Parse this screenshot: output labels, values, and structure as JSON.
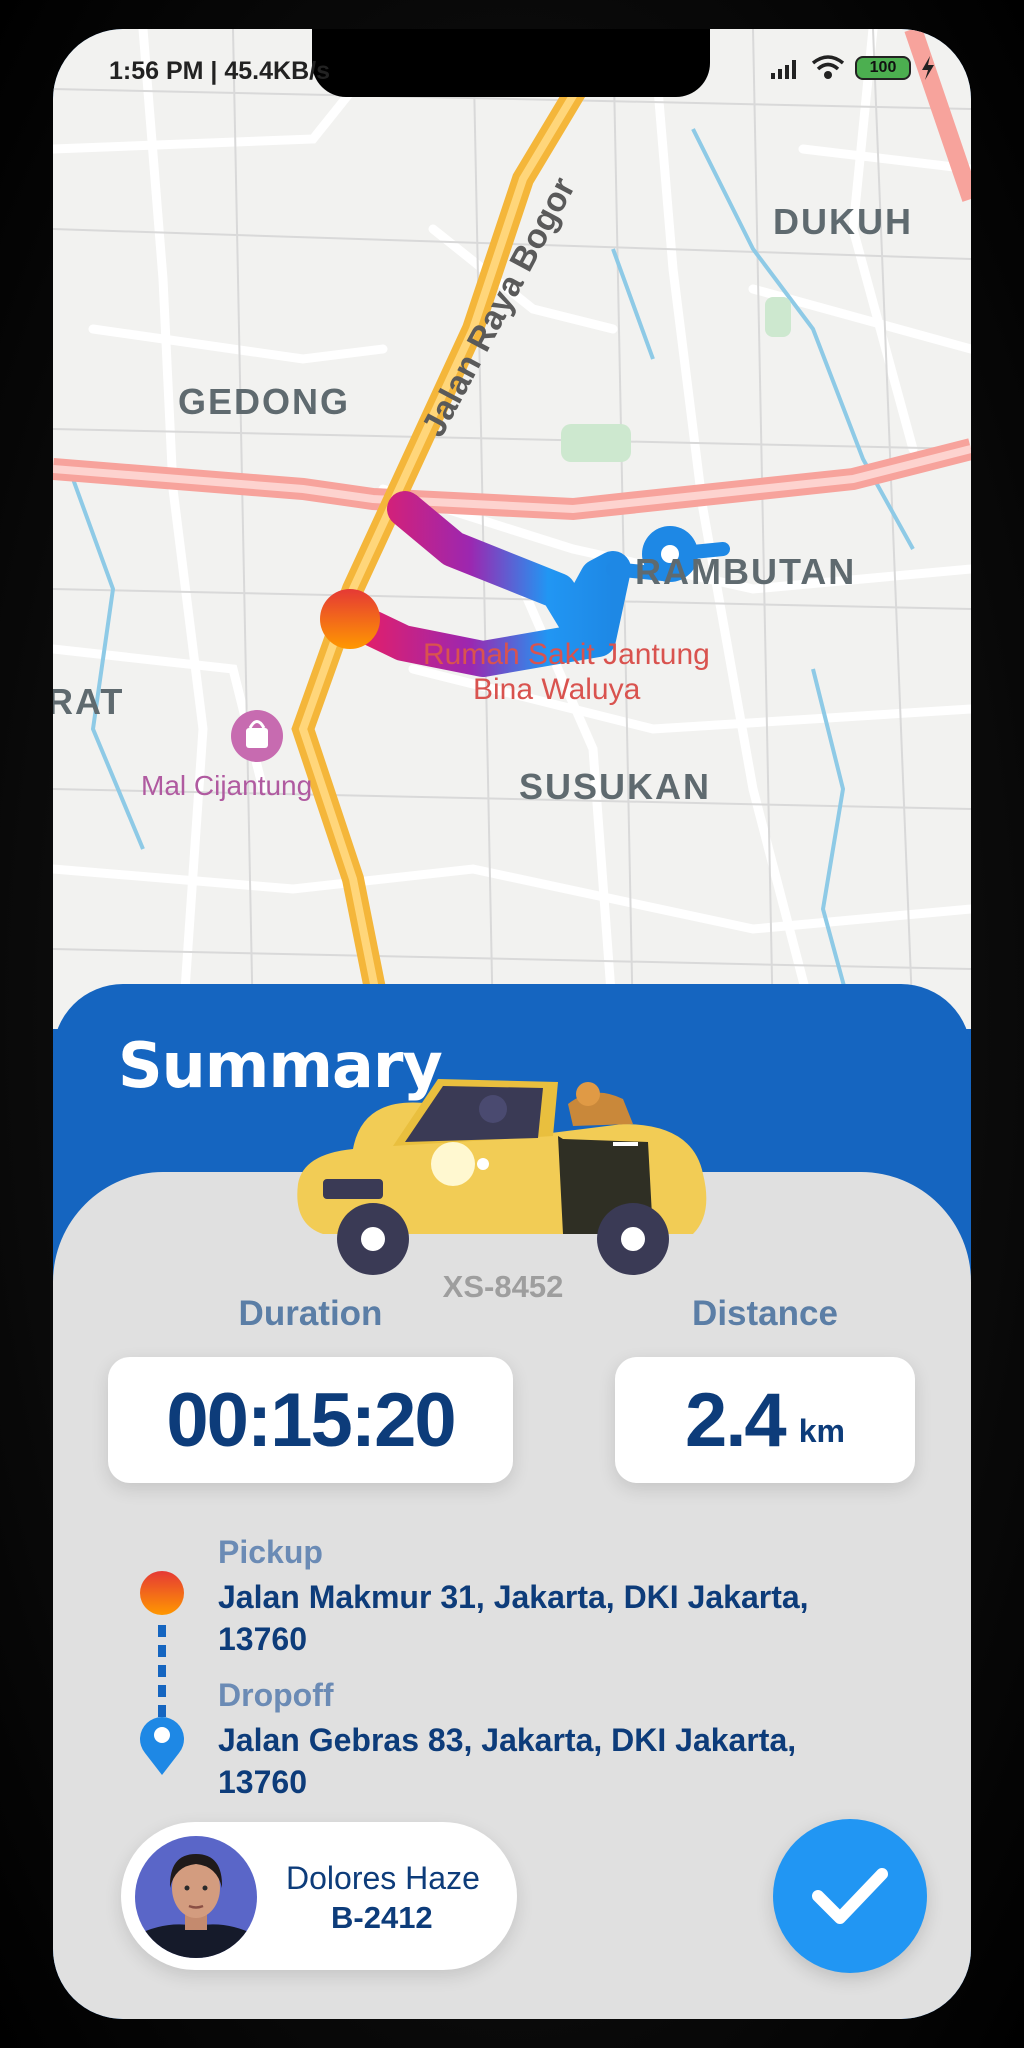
{
  "status_bar": {
    "time": "1:56 PM | 45.4KB/s",
    "battery": "100"
  },
  "map": {
    "labels": {
      "dukuh": "DUKUH",
      "gedong": "GEDONG",
      "rambutan": "RAMBUTAN",
      "rat": "RAT",
      "susukan": "SUSUKAN",
      "road": "Jalan Raya Bogor",
      "hospital_line1": "Rumah Sakit Jantung",
      "hospital_line2": "Bina Waluya",
      "mall": "Mal Cijantung"
    }
  },
  "summary": {
    "title": "Summary",
    "plate": "XS-8452",
    "duration_label": "Duration",
    "duration_value": "00:15:20",
    "distance_label": "Distance",
    "distance_value": "2.4",
    "distance_unit": "km"
  },
  "route": {
    "pickup_label": "Pickup",
    "pickup_address": "Jalan Makmur 31, Jakarta, DKI Jakarta, 13760",
    "dropoff_label": "Dropoff",
    "dropoff_address": "Jalan Gebras 83, Jakarta, DKI Jakarta, 13760"
  },
  "driver": {
    "name": "Dolores Haze",
    "id": "B-2412"
  },
  "colors": {
    "primary": "#1565c0",
    "accent": "#2196f3",
    "text_dark": "#0d3c7a",
    "pickup_start": "#e53935",
    "pickup_end": "#ff9800"
  }
}
